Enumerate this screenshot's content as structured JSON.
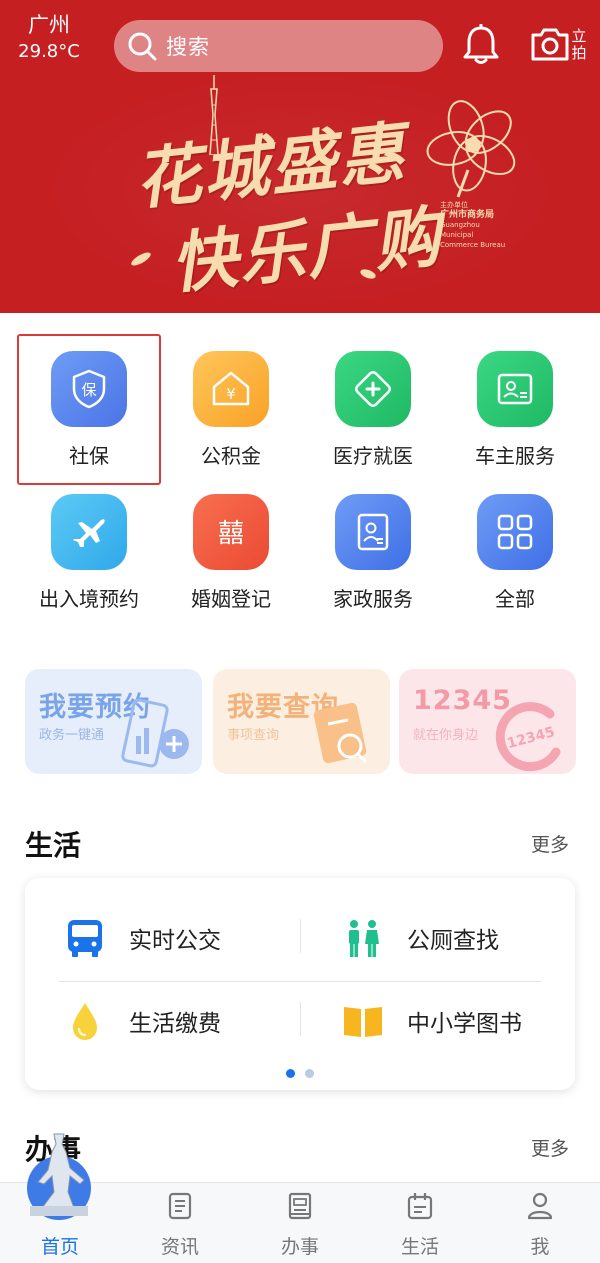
{
  "header": {
    "city": "广州",
    "temperature": "29.8°C",
    "search_placeholder": "搜索",
    "snap_label_top": "立",
    "snap_label_bottom": "拍"
  },
  "banner": {
    "line1": "花城盛惠",
    "line2": "快乐广购",
    "host_caption": "主办单位",
    "host_name": "广州市商务局",
    "host_english": "Guangzhou Municipal Commerce Bureau",
    "background_color": "#c51f22"
  },
  "services": [
    {
      "label": "社保",
      "icon": "social-insurance-shield-icon",
      "color": "#5b87f0",
      "highlighted": true
    },
    {
      "label": "公积金",
      "icon": "housing-fund-house-icon",
      "color": "#fbb03b"
    },
    {
      "label": "医疗就医",
      "icon": "medical-cross-icon",
      "color": "#25c870"
    },
    {
      "label": "车主服务",
      "icon": "driver-license-icon",
      "color": "#25c870"
    },
    {
      "label": "出入境预约",
      "icon": "airplane-icon",
      "color": "#3cb6f0"
    },
    {
      "label": "婚姻登记",
      "icon": "double-happiness-icon",
      "color": "#f2583e"
    },
    {
      "label": "家政服务",
      "icon": "id-card-icon",
      "color": "#4a7fef"
    },
    {
      "label": "全部",
      "icon": "all-grid-icon",
      "color": "#4a7fef"
    }
  ],
  "quick_cards": [
    {
      "title": "我要预约",
      "subtitle": "政务一键通",
      "color": "#7aa4e8",
      "bg": "#e6eefc"
    },
    {
      "title": "我要查询",
      "subtitle": "事项查询",
      "color": "#f5b77a",
      "bg": "#fcefe2"
    },
    {
      "title": "12345",
      "subtitle": "就在你身边",
      "color": "#f29aa6",
      "bg": "#fde6ea"
    }
  ],
  "life_section": {
    "title": "生活",
    "more": "更多",
    "items": [
      {
        "label": "实时公交",
        "icon": "bus-icon"
      },
      {
        "label": "公厕查找",
        "icon": "restroom-icon"
      },
      {
        "label": "生活缴费",
        "icon": "water-drop-icon"
      },
      {
        "label": "中小学图书",
        "icon": "book-icon"
      }
    ],
    "page_count": 2,
    "active_page": 1
  },
  "affairs_section": {
    "title": "办事",
    "more": "更多"
  },
  "bottom_nav": [
    {
      "label": "首页",
      "icon": "home-statue-icon",
      "active": true
    },
    {
      "label": "资讯",
      "icon": "news-icon"
    },
    {
      "label": "办事",
      "icon": "affairs-icon"
    },
    {
      "label": "生活",
      "icon": "calendar-icon"
    },
    {
      "label": "我",
      "icon": "user-icon"
    }
  ]
}
